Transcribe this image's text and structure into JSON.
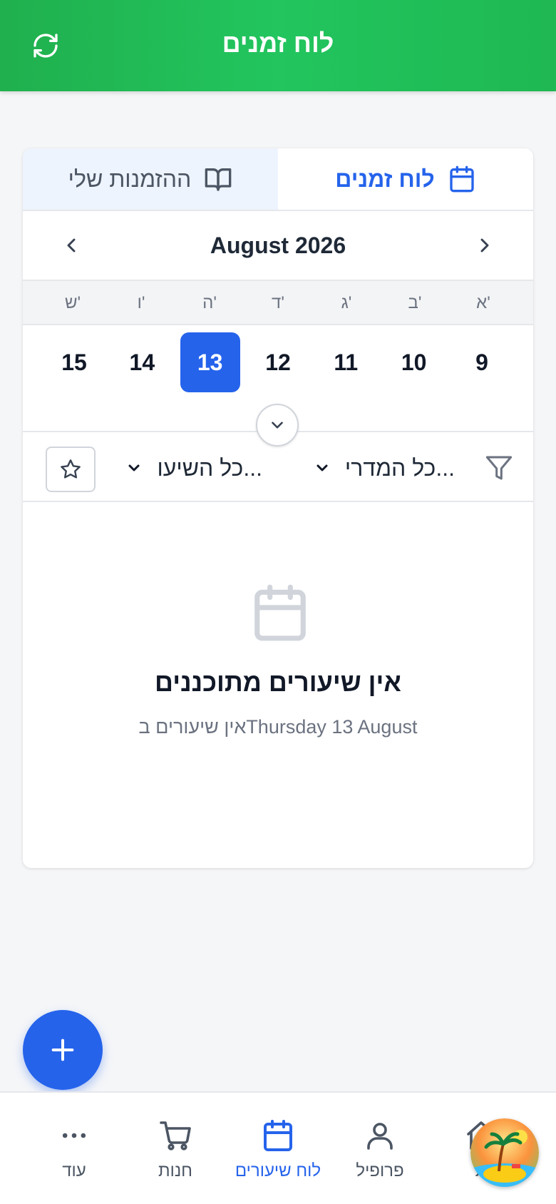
{
  "header": {
    "title": "לוח זמנים",
    "refresh_icon": "refresh-icon"
  },
  "tabs": [
    {
      "label": "לוח זמנים",
      "icon": "calendar-icon",
      "active": true
    },
    {
      "label": "ההזמנות שלי",
      "icon": "book-open-icon",
      "active": false
    }
  ],
  "calendar": {
    "month_label": "August 2026",
    "weekdays": [
      "א'",
      "ב'",
      "ג'",
      "ד'",
      "ה'",
      "ו'",
      "ש'"
    ],
    "days": [
      "9",
      "10",
      "11",
      "12",
      "13",
      "14",
      "15"
    ],
    "selected_day": "13"
  },
  "filters": {
    "coach_select": "כל המדרי...",
    "lesson_select": "כל השיעו..."
  },
  "empty_state": {
    "title": "אין שיעורים מתוכננים",
    "subtitle": "אין שיעורים בThursday 13 August"
  },
  "bottom_nav": {
    "items": [
      {
        "label": "עוד",
        "icon": "more-icon"
      },
      {
        "label": "חנות",
        "icon": "cart-icon"
      },
      {
        "label": "לוח שיעורים",
        "icon": "calendar-icon",
        "active": true
      },
      {
        "label": "פרופיל",
        "icon": "user-icon"
      },
      {
        "label": "ת",
        "icon": "home-icon"
      }
    ]
  },
  "colors": {
    "header": "#22c55e",
    "accent": "#2563eb",
    "text": "#111827",
    "muted": "#6b7280"
  }
}
